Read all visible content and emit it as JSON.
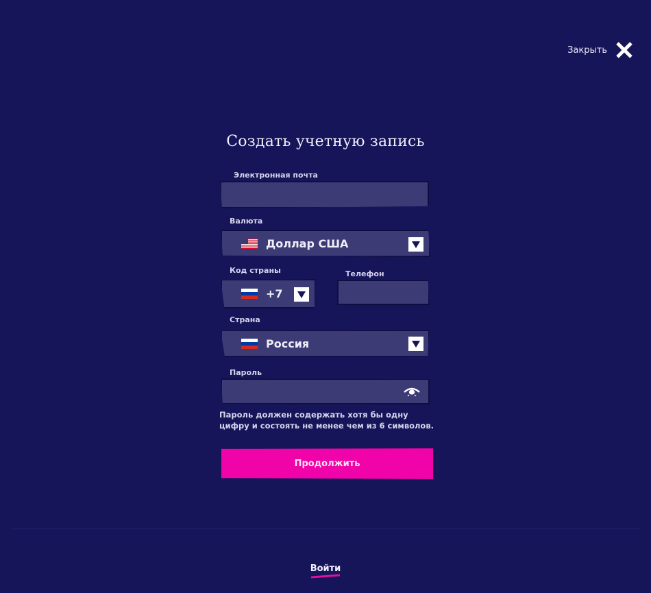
{
  "close": {
    "label": "Закрыть",
    "icon": "close-icon"
  },
  "title": "Создать учетную запись",
  "email": {
    "label": "Электронная почта",
    "value": ""
  },
  "currency": {
    "label": "Валюта",
    "value": "Доллар США",
    "flag_icon": "us-flag-icon"
  },
  "country_code": {
    "label": "Код страны",
    "value": "+7",
    "flag_icon": "ru-flag-icon"
  },
  "phone": {
    "label": "Телефон",
    "value": ""
  },
  "country": {
    "label": "Страна",
    "value": "Россия",
    "flag_icon": "ru-flag-icon"
  },
  "password": {
    "label": "Пароль",
    "value": "",
    "icon": "eye-icon"
  },
  "hint": "Пароль должен содержать хотя бы одну цифру и состоять не менее чем из 6 символов.",
  "submit_label": "Продолжить",
  "login_label": "Войти",
  "colors": {
    "background": "#16155a",
    "field": "#3d3b75",
    "accent": "#f003a8"
  }
}
